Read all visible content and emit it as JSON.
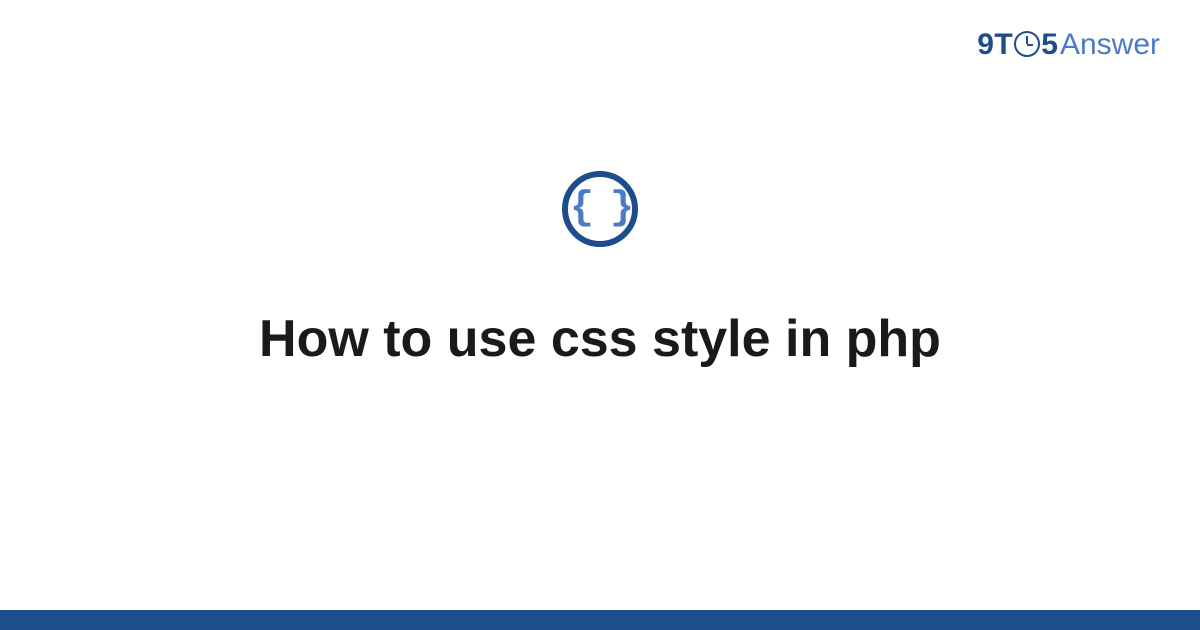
{
  "brand": {
    "part1": "9T",
    "part2": "5",
    "part3": "Answer"
  },
  "icon": {
    "glyph": "{ }",
    "semantic": "code-braces"
  },
  "title": "How to use css style in php",
  "colors": {
    "primary": "#1e4d8b",
    "accent": "#4a7bc4",
    "text": "#1a1a1a",
    "background": "#ffffff"
  }
}
